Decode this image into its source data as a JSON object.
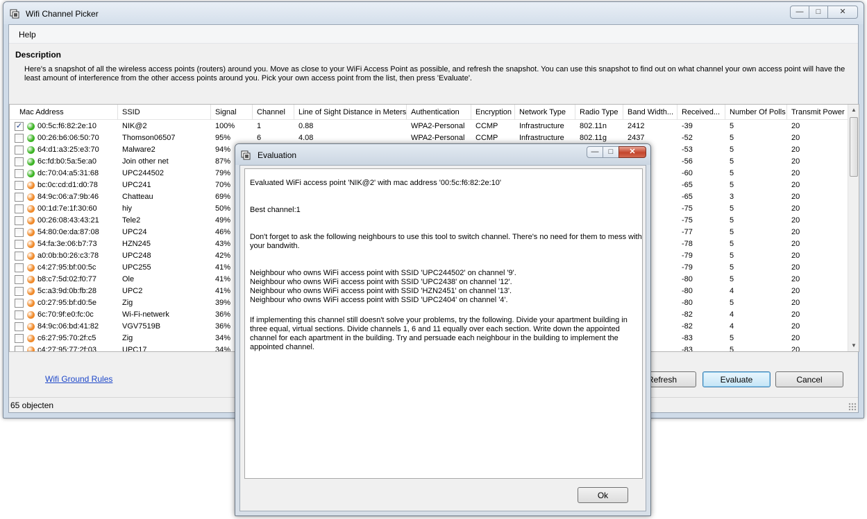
{
  "window": {
    "title": "Wifi Channel Picker"
  },
  "menu": {
    "help": "Help"
  },
  "description": {
    "title": "Description",
    "text": "Here's a snapshot of all the wireless access points (routers) around you. Move as close to your WiFi Access Point as possible, and refresh the snapshot. You can use this snapshot to find out on what channel your own access point will have the least amount of interference from the other access points around you. Pick your own access point from the list, then press 'Evaluate'."
  },
  "columns": [
    "Mac Address",
    "SSID",
    "Signal",
    "Channel",
    "Line of Sight Distance in Meters",
    "Authentication",
    "Encryption",
    "Network Type",
    "Radio Type",
    "Band Width...",
    "Received...",
    "Number Of Polls",
    "Transmit Power"
  ],
  "colors": {
    "green": "#3cb424",
    "orange": "#f08a2a",
    "link": "#1c46c9"
  },
  "rows": [
    {
      "checked": true,
      "status": "green",
      "mac": "00:5c:f6:82:2e:10",
      "ssid": "NIK@2",
      "signal": "100%",
      "channel": "1",
      "distance": "0.88",
      "auth": "WPA2-Personal",
      "enc": "CCMP",
      "nettype": "Infrastructure",
      "radio": "802.11n",
      "band": "2412",
      "received": "-39",
      "polls": "5",
      "power": "20"
    },
    {
      "checked": false,
      "status": "green",
      "mac": "00:26:b6:06:50:70",
      "ssid": "Thomson06507",
      "signal": "95%",
      "channel": "6",
      "distance": "4.08",
      "auth": "WPA2-Personal",
      "enc": "CCMP",
      "nettype": "Infrastructure",
      "radio": "802.11g",
      "band": "2437",
      "received": "-52",
      "polls": "5",
      "power": "20"
    },
    {
      "checked": false,
      "status": "green",
      "mac": "64:d1:a3:25:e3:70",
      "ssid": "Malware2",
      "signal": "94%",
      "received": "-53",
      "polls": "5",
      "power": "20"
    },
    {
      "checked": false,
      "status": "green",
      "mac": "6c:fd:b0:5a:5e:a0",
      "ssid": "Join other net",
      "signal": "87%",
      "received": "-56",
      "polls": "5",
      "power": "20"
    },
    {
      "checked": false,
      "status": "green",
      "mac": "dc:70:04:a5:31:68",
      "ssid": "UPC244502",
      "signal": "79%",
      "received": "-60",
      "polls": "5",
      "power": "20"
    },
    {
      "checked": false,
      "status": "orange",
      "mac": "bc:0c:cd:d1:d0:78",
      "ssid": "UPC241",
      "signal": "70%",
      "received": "-65",
      "polls": "5",
      "power": "20"
    },
    {
      "checked": false,
      "status": "orange",
      "mac": "84:9c:06:a7:9b:46",
      "ssid": "Chatteau",
      "signal": "69%",
      "received": "-65",
      "polls": "3",
      "power": "20"
    },
    {
      "checked": false,
      "status": "orange",
      "mac": "00:1d:7e:1f:30:60",
      "ssid": "hiy",
      "signal": "50%",
      "received": "-75",
      "polls": "5",
      "power": "20"
    },
    {
      "checked": false,
      "status": "orange",
      "mac": "00:26:08:43:43:21",
      "ssid": "Tele2",
      "signal": "49%",
      "received": "-75",
      "polls": "5",
      "power": "20"
    },
    {
      "checked": false,
      "status": "orange",
      "mac": "54:80:0e:da:87:08",
      "ssid": "UPC24",
      "signal": "46%",
      "received": "-77",
      "polls": "5",
      "power": "20"
    },
    {
      "checked": false,
      "status": "orange",
      "mac": "54:fa:3e:06:b7:73",
      "ssid": "HZN245",
      "signal": "43%",
      "received": "-78",
      "polls": "5",
      "power": "20"
    },
    {
      "checked": false,
      "status": "orange",
      "mac": "a0:0b:b0:26:c3:78",
      "ssid": "UPC248",
      "signal": "42%",
      "received": "-79",
      "polls": "5",
      "power": "20"
    },
    {
      "checked": false,
      "status": "orange",
      "mac": "c4:27:95:bf:00:5c",
      "ssid": "UPC255",
      "signal": "41%",
      "received": "-79",
      "polls": "5",
      "power": "20"
    },
    {
      "checked": false,
      "status": "orange",
      "mac": "b8:c7:5d:02:f0:77",
      "ssid": "Ole",
      "signal": "41%",
      "received": "-80",
      "polls": "5",
      "power": "20"
    },
    {
      "checked": false,
      "status": "orange",
      "mac": "5c:a3:9d:0b:fb:28",
      "ssid": "UPC2",
      "signal": "41%",
      "received": "-80",
      "polls": "4",
      "power": "20"
    },
    {
      "checked": false,
      "status": "orange",
      "mac": "c0:27:95:bf:d0:5e",
      "ssid": "Zig",
      "signal": "39%",
      "received": "-80",
      "polls": "5",
      "power": "20"
    },
    {
      "checked": false,
      "status": "orange",
      "mac": "6c:70:9f:e0:fc:0c",
      "ssid": "Wi-Fi-netwerk",
      "signal": "36%",
      "received": "-82",
      "polls": "4",
      "power": "20"
    },
    {
      "checked": false,
      "status": "orange",
      "mac": "84:9c:06:bd:41:82",
      "ssid": "VGV7519B",
      "signal": "36%",
      "received": "-82",
      "polls": "4",
      "power": "20"
    },
    {
      "checked": false,
      "status": "orange",
      "mac": "c6:27:95:70:2f:c5",
      "ssid": "Zig",
      "signal": "34%",
      "received": "-83",
      "polls": "5",
      "power": "20"
    },
    {
      "checked": false,
      "status": "orange",
      "mac": "c4:27:95:77:2f:03",
      "ssid": "UPC17",
      "signal": "34%",
      "received": "-83",
      "polls": "5",
      "power": "20"
    }
  ],
  "link": {
    "ground_rules": "Wifi Ground Rules"
  },
  "buttons": {
    "refresh": "Refresh",
    "evaluate": "Evaluate",
    "cancel": "Cancel"
  },
  "status": {
    "text": "65 objecten"
  },
  "dialog": {
    "title": "Evaluation",
    "ok": "Ok",
    "lines": [
      "Evaluated WiFi access point 'NIK@2' with mac address '00:5c:f6:82:2e:10'",
      "Best channel:1",
      "Don't forget to ask the following neighbours to use this tool to switch channel. There's no need for them to mess with your bandwith.",
      "Neighbour who owns WiFi access point with SSID 'UPC244502' on channel '9'.",
      "Neighbour who owns WiFi access point with SSID 'UPC2438' on channel '12'.",
      "Neighbour who owns WiFi access point with SSID 'HZN2451' on channel '13'.",
      "Neighbour who owns WiFi access point with SSID 'UPC2404' on channel '4'.",
      "If implementing this channel still doesn't solve your problems, try the following. Divide your apartment building in three equal, virtual sections. Divide channels 1, 6 and 11 equally over each section. Write down the appointed channel for each apartment in the building. Try and persuade each neighbour in the building to implement the appointed channel."
    ]
  }
}
